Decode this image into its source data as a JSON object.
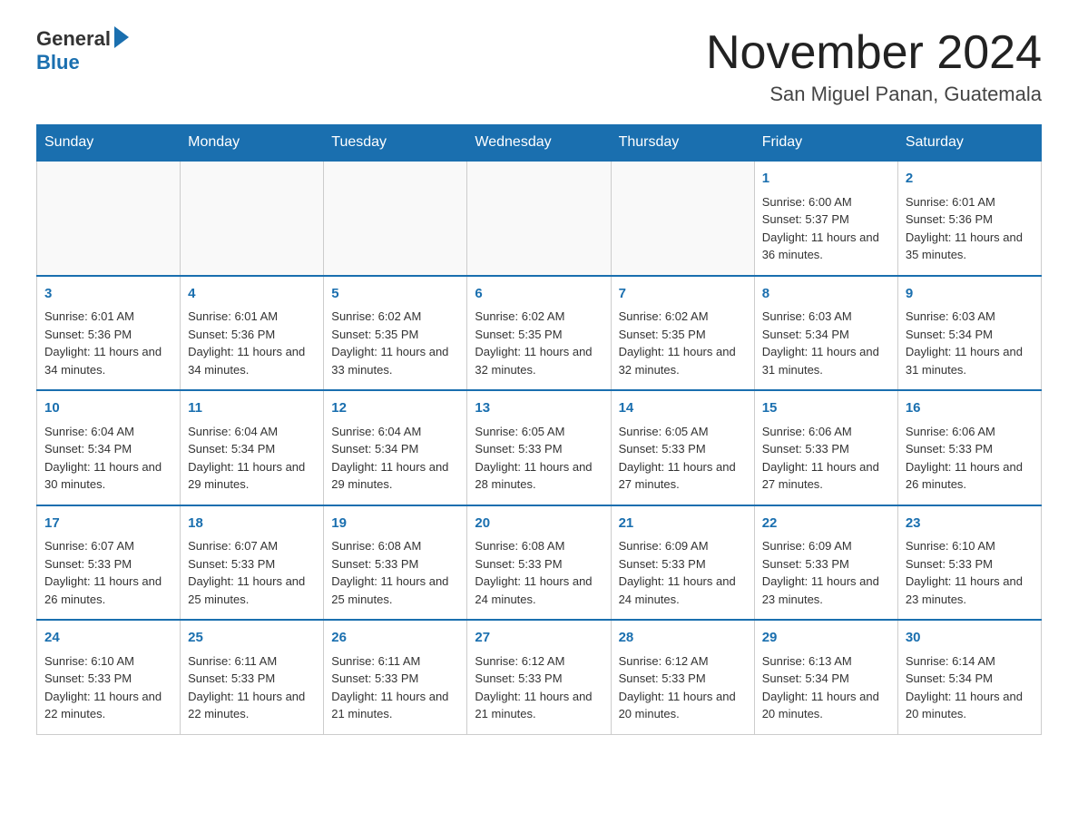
{
  "header": {
    "logo_general": "General",
    "logo_blue": "Blue",
    "title": "November 2024",
    "subtitle": "San Miguel Panan, Guatemala"
  },
  "days_of_week": [
    "Sunday",
    "Monday",
    "Tuesday",
    "Wednesday",
    "Thursday",
    "Friday",
    "Saturday"
  ],
  "weeks": [
    [
      {
        "day": "",
        "info": ""
      },
      {
        "day": "",
        "info": ""
      },
      {
        "day": "",
        "info": ""
      },
      {
        "day": "",
        "info": ""
      },
      {
        "day": "",
        "info": ""
      },
      {
        "day": "1",
        "info": "Sunrise: 6:00 AM\nSunset: 5:37 PM\nDaylight: 11 hours and 36 minutes."
      },
      {
        "day": "2",
        "info": "Sunrise: 6:01 AM\nSunset: 5:36 PM\nDaylight: 11 hours and 35 minutes."
      }
    ],
    [
      {
        "day": "3",
        "info": "Sunrise: 6:01 AM\nSunset: 5:36 PM\nDaylight: 11 hours and 34 minutes."
      },
      {
        "day": "4",
        "info": "Sunrise: 6:01 AM\nSunset: 5:36 PM\nDaylight: 11 hours and 34 minutes."
      },
      {
        "day": "5",
        "info": "Sunrise: 6:02 AM\nSunset: 5:35 PM\nDaylight: 11 hours and 33 minutes."
      },
      {
        "day": "6",
        "info": "Sunrise: 6:02 AM\nSunset: 5:35 PM\nDaylight: 11 hours and 32 minutes."
      },
      {
        "day": "7",
        "info": "Sunrise: 6:02 AM\nSunset: 5:35 PM\nDaylight: 11 hours and 32 minutes."
      },
      {
        "day": "8",
        "info": "Sunrise: 6:03 AM\nSunset: 5:34 PM\nDaylight: 11 hours and 31 minutes."
      },
      {
        "day": "9",
        "info": "Sunrise: 6:03 AM\nSunset: 5:34 PM\nDaylight: 11 hours and 31 minutes."
      }
    ],
    [
      {
        "day": "10",
        "info": "Sunrise: 6:04 AM\nSunset: 5:34 PM\nDaylight: 11 hours and 30 minutes."
      },
      {
        "day": "11",
        "info": "Sunrise: 6:04 AM\nSunset: 5:34 PM\nDaylight: 11 hours and 29 minutes."
      },
      {
        "day": "12",
        "info": "Sunrise: 6:04 AM\nSunset: 5:34 PM\nDaylight: 11 hours and 29 minutes."
      },
      {
        "day": "13",
        "info": "Sunrise: 6:05 AM\nSunset: 5:33 PM\nDaylight: 11 hours and 28 minutes."
      },
      {
        "day": "14",
        "info": "Sunrise: 6:05 AM\nSunset: 5:33 PM\nDaylight: 11 hours and 27 minutes."
      },
      {
        "day": "15",
        "info": "Sunrise: 6:06 AM\nSunset: 5:33 PM\nDaylight: 11 hours and 27 minutes."
      },
      {
        "day": "16",
        "info": "Sunrise: 6:06 AM\nSunset: 5:33 PM\nDaylight: 11 hours and 26 minutes."
      }
    ],
    [
      {
        "day": "17",
        "info": "Sunrise: 6:07 AM\nSunset: 5:33 PM\nDaylight: 11 hours and 26 minutes."
      },
      {
        "day": "18",
        "info": "Sunrise: 6:07 AM\nSunset: 5:33 PM\nDaylight: 11 hours and 25 minutes."
      },
      {
        "day": "19",
        "info": "Sunrise: 6:08 AM\nSunset: 5:33 PM\nDaylight: 11 hours and 25 minutes."
      },
      {
        "day": "20",
        "info": "Sunrise: 6:08 AM\nSunset: 5:33 PM\nDaylight: 11 hours and 24 minutes."
      },
      {
        "day": "21",
        "info": "Sunrise: 6:09 AM\nSunset: 5:33 PM\nDaylight: 11 hours and 24 minutes."
      },
      {
        "day": "22",
        "info": "Sunrise: 6:09 AM\nSunset: 5:33 PM\nDaylight: 11 hours and 23 minutes."
      },
      {
        "day": "23",
        "info": "Sunrise: 6:10 AM\nSunset: 5:33 PM\nDaylight: 11 hours and 23 minutes."
      }
    ],
    [
      {
        "day": "24",
        "info": "Sunrise: 6:10 AM\nSunset: 5:33 PM\nDaylight: 11 hours and 22 minutes."
      },
      {
        "day": "25",
        "info": "Sunrise: 6:11 AM\nSunset: 5:33 PM\nDaylight: 11 hours and 22 minutes."
      },
      {
        "day": "26",
        "info": "Sunrise: 6:11 AM\nSunset: 5:33 PM\nDaylight: 11 hours and 21 minutes."
      },
      {
        "day": "27",
        "info": "Sunrise: 6:12 AM\nSunset: 5:33 PM\nDaylight: 11 hours and 21 minutes."
      },
      {
        "day": "28",
        "info": "Sunrise: 6:12 AM\nSunset: 5:33 PM\nDaylight: 11 hours and 20 minutes."
      },
      {
        "day": "29",
        "info": "Sunrise: 6:13 AM\nSunset: 5:34 PM\nDaylight: 11 hours and 20 minutes."
      },
      {
        "day": "30",
        "info": "Sunrise: 6:14 AM\nSunset: 5:34 PM\nDaylight: 11 hours and 20 minutes."
      }
    ]
  ]
}
